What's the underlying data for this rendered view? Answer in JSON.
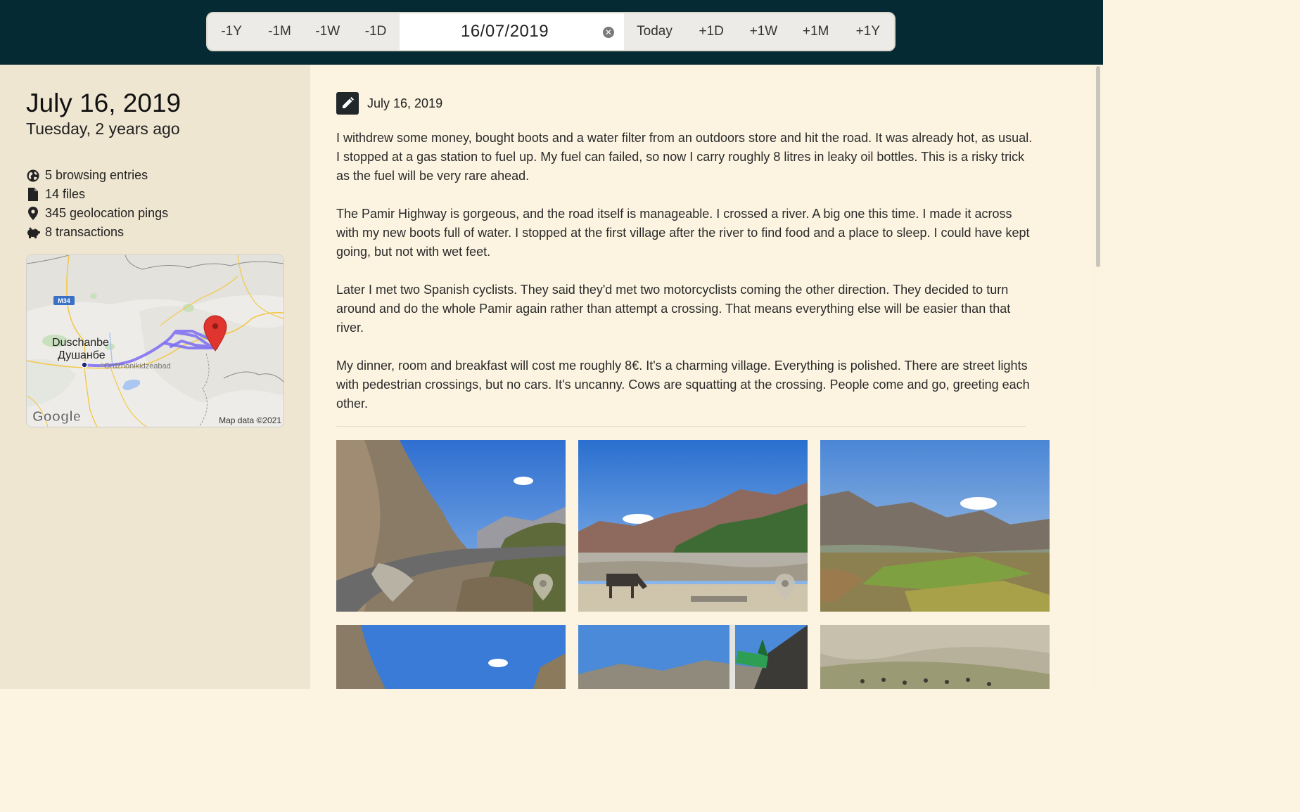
{
  "date_nav": {
    "back_buttons": [
      "-1Y",
      "-1M",
      "-1W",
      "-1D"
    ],
    "date_value": "16/07/2019",
    "today_label": "Today",
    "forward_buttons": [
      "+1D",
      "+1W",
      "+1M",
      "+1Y"
    ]
  },
  "sidebar": {
    "date": "July 16, 2019",
    "subtitle": "Tuesday, 2 years ago",
    "stats": [
      {
        "icon": "globe-icon",
        "label": "5 browsing entries"
      },
      {
        "icon": "file-icon",
        "label": "14 files"
      },
      {
        "icon": "map-pin-icon",
        "label": "345 geolocation pings"
      },
      {
        "icon": "piggy-bank-icon",
        "label": "8 transactions"
      }
    ],
    "map": {
      "road_label": "M34",
      "city_latin": "Duschanbe",
      "city_cyrillic": "Душанбе",
      "town_label": "Ordzhonikidzeabad",
      "google_logo": "Google",
      "attribution": "Map data ©2021",
      "route_color": "#7b6cf2",
      "pin_color": "#e0342f"
    }
  },
  "entry": {
    "date": "July 16, 2019",
    "paragraphs": [
      "I withdrew some money, bought boots and a water filter from an outdoors store and hit the road. It was already hot, as usual. I stopped at a gas station to fuel up. My fuel can failed, so now I carry roughly 8 litres in leaky oil bottles. This is a risky trick as the fuel will be very rare ahead.",
      "The Pamir Highway is gorgeous, and the road itself is manageable. I crossed a river. A big one this time. I made it across with my new boots full of water. I stopped at the first village after the river to find food and a place to sleep. I could have kept going, but not with wet feet.",
      "Later I met two Spanish cyclists. They said they'd met two motorcyclists coming the other direction. They decided to turn around and do the whole Pamir again rather than attempt a crossing. That means everything else will be easier than that river.",
      "My dinner, room and breakfast will cost me roughly 8€. It's a charming village. Everything is polished. There are street lights with pedestrian crossings, but no cars. It's uncanny. Cows are squatting at the crossing. People come and go, greeting each other."
    ]
  },
  "colors": {
    "topbar": "#062a33",
    "sidebar_bg": "#efe6d1",
    "main_bg": "#fcf4e1"
  }
}
